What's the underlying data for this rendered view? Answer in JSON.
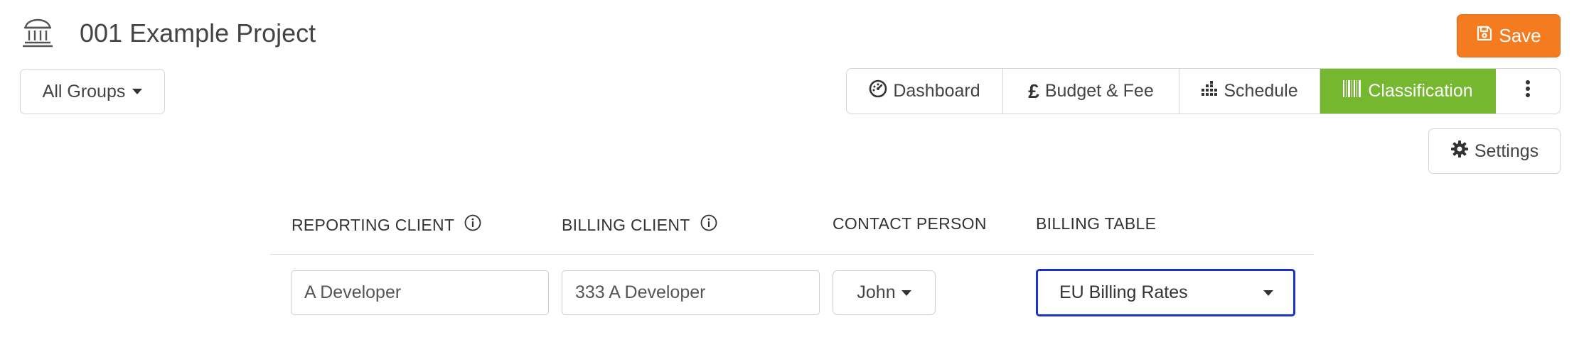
{
  "header": {
    "title": "001 Example Project",
    "project_icon": "building-columns-icon",
    "save_label": "Save",
    "save_icon": "floppy-disk-icon",
    "save_color": "#f47b20"
  },
  "groups": {
    "label": "All Groups"
  },
  "nav": {
    "items": [
      {
        "label": "Dashboard",
        "icon": "gauge-icon"
      },
      {
        "label": "Budget & Fee",
        "icon": "pound-sign-icon"
      },
      {
        "label": "Schedule",
        "icon": "bar-chart-icon"
      },
      {
        "label": "Classification",
        "icon": "barcode-icon",
        "active": true
      }
    ],
    "more_icon": "vertical-ellipsis-icon",
    "active_color": "#75b72e"
  },
  "settings": {
    "label": "Settings",
    "icon": "gear-icon"
  },
  "table": {
    "headers": [
      "REPORTING CLIENT",
      "BILLING CLIENT",
      "CONTACT PERSON",
      "BILLING TABLE"
    ],
    "row": {
      "reporting_client": "A Developer",
      "billing_client": "333 A Developer",
      "contact_person": "John",
      "billing_table": "EU Billing Rates"
    },
    "focus_color": "#1a33cc"
  }
}
